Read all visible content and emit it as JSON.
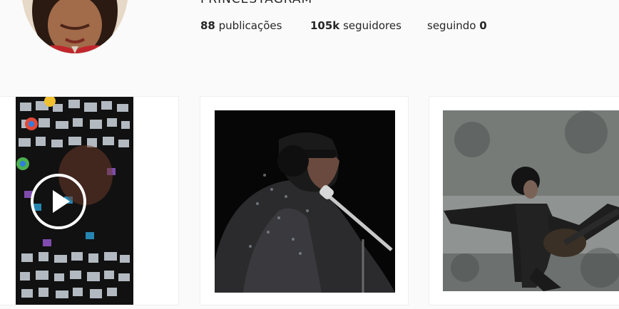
{
  "profile": {
    "username": "PRINCESTAGRAM",
    "stats": {
      "posts_count": "88",
      "posts_label": "publicações",
      "followers_count": "105k",
      "followers_label": "seguidores",
      "following_label": "seguindo",
      "following_count": "0"
    }
  },
  "posts": [
    {
      "type": "video",
      "icon": "play-icon"
    },
    {
      "type": "image"
    },
    {
      "type": "image"
    }
  ],
  "colors": {
    "background": "#fafafa",
    "tile": "#ffffff",
    "text": "#262626"
  }
}
